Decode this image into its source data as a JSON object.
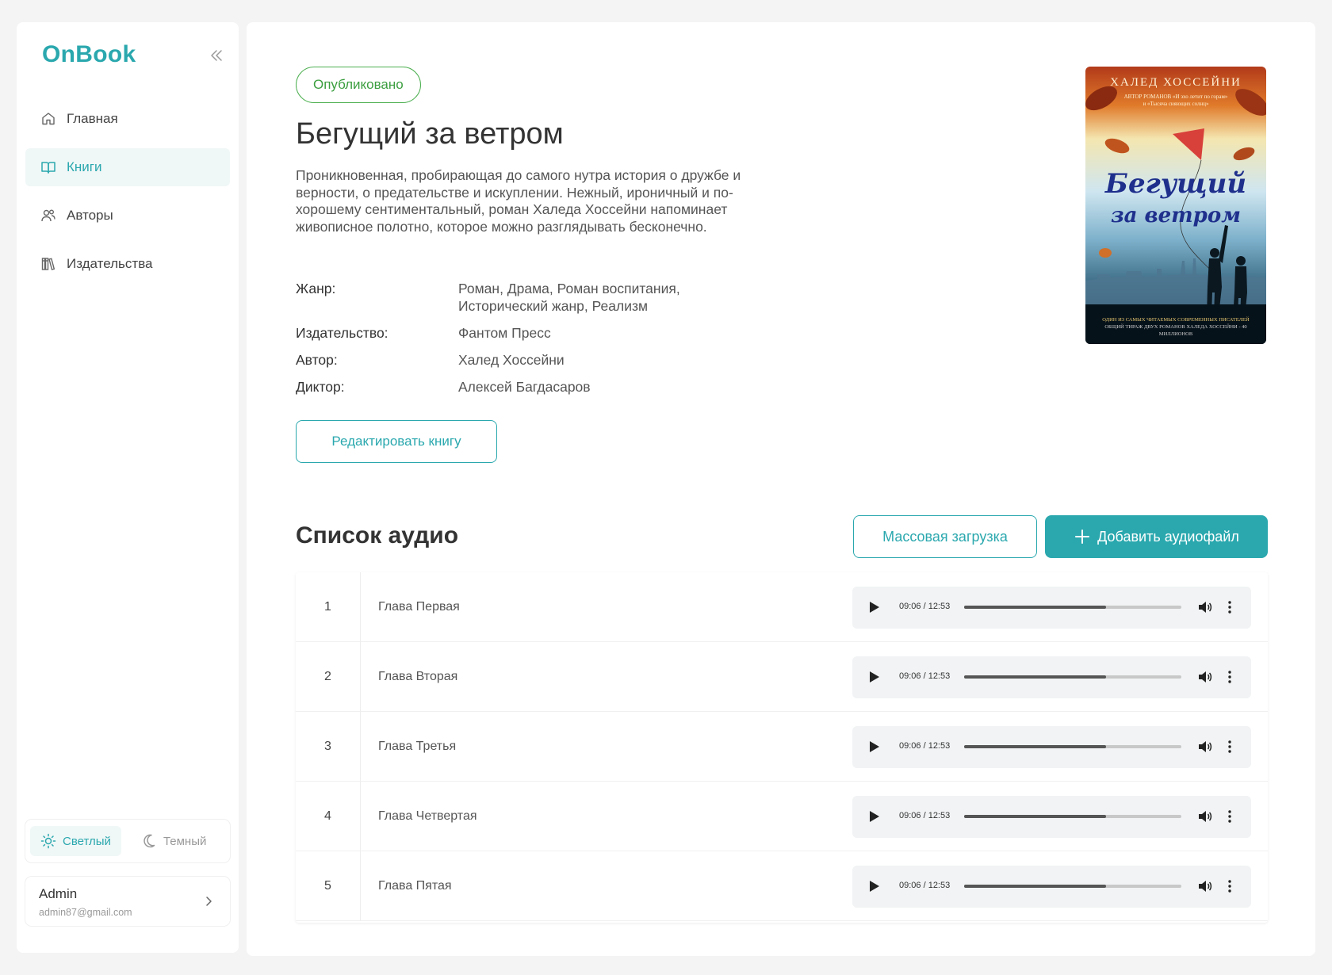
{
  "app": {
    "name": "OnBook"
  },
  "sidebar": {
    "items": [
      {
        "label": "Главная",
        "icon": "home-icon",
        "active": false
      },
      {
        "label": "Книги",
        "icon": "book-icon",
        "active": true
      },
      {
        "label": "Авторы",
        "icon": "users-icon",
        "active": false
      },
      {
        "label": "Издательства",
        "icon": "library-icon",
        "active": false
      }
    ],
    "theme": {
      "light": "Светлый",
      "dark": "Темный",
      "selected": "light"
    },
    "user": {
      "name": "Admin",
      "email": "admin87@gmail.com"
    }
  },
  "book": {
    "status": "Опубликовано",
    "title": "Бегущий за ветром",
    "description": "Проникновенная, пробирающая до самого нутра история о дружбе и верности, о предательстве и искуплении. Нежный, ироничный и по-хорошему сентиментальный, роман Халеда Хоссейни напоминает живописное полотно, которое можно разглядывать бесконечно.",
    "meta": {
      "genre_label": "Жанр:",
      "genre": "Роман, Драма, Роман воспитания, Исторический жанр, Реализм",
      "publisher_label": "Издательство:",
      "publisher": "Фантом Пресс",
      "author_label": "Автор:",
      "author": "Халед Хоссейни",
      "narrator_label": "Диктор:",
      "narrator": "Алексей Багдасаров"
    },
    "edit_label": "Редактировать книгу",
    "cover": {
      "author": "ХАЛЕД ХОССЕЙНИ",
      "subtitle_1": "АВТОР РОМАНОВ «И эхо летит по горам»",
      "subtitle_2": "и «Тысяча сияющих солнц»",
      "title_1": "Бегущий",
      "title_2": "за ветром",
      "bottom_1": "ОДИН ИЗ САМЫХ ЧИТАЕМЫХ СОВРЕМЕННЫХ ПИСАТЕЛЕЙ",
      "bottom_2": "ОБЩИЙ ТИРАЖ ДВУХ РОМАНОВ ХАЛЕДА ХОССЕЙНИ - 40 МИЛЛИОНОВ"
    }
  },
  "audio": {
    "title": "Список аудио",
    "bulk_label": "Массовая загрузка",
    "add_label": "Добавить аудиофайл",
    "items": [
      {
        "num": "1",
        "name": "Глава Первая",
        "time": "09:06 / 12:53",
        "progress": 0.653
      },
      {
        "num": "2",
        "name": "Глава Вторая",
        "time": "09:06 / 12:53",
        "progress": 0.653
      },
      {
        "num": "3",
        "name": "Глава Третья",
        "time": "09:06 / 12:53",
        "progress": 0.653
      },
      {
        "num": "4",
        "name": "Глава Четвертая",
        "time": "09:06 / 12:53",
        "progress": 0.653
      },
      {
        "num": "5",
        "name": "Глава Пятая",
        "time": "09:06 / 12:53",
        "progress": 0.653
      }
    ]
  },
  "colors": {
    "accent": "#2aa8ae",
    "published": "#4caf50"
  }
}
